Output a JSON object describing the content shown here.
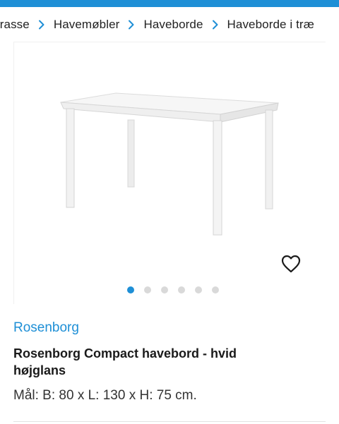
{
  "colors": {
    "accent": "#1e8fd6",
    "text": "#1a1a1a"
  },
  "breadcrumb": {
    "items": [
      {
        "label": "rrasse"
      },
      {
        "label": "Havemøbler"
      },
      {
        "label": "Haveborde"
      },
      {
        "label": "Haveborde i træ"
      }
    ]
  },
  "gallery": {
    "icons": {
      "favorite": "heart-icon"
    },
    "dots_total": 6,
    "active_dot": 1
  },
  "product": {
    "brand": "Rosenborg",
    "title": "Rosenborg Compact havebord - hvid højglans",
    "dimensions": "Mål: B: 80 x L: 130 x H: 75 cm."
  }
}
